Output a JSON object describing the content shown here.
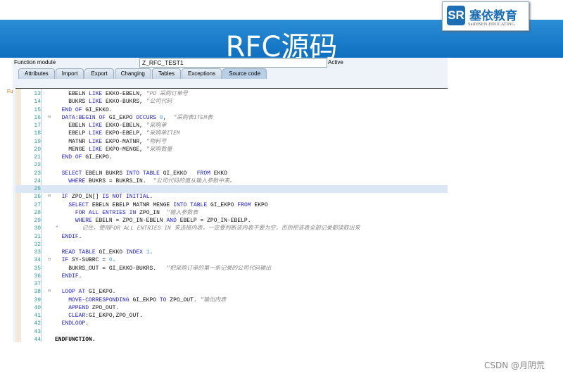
{
  "slide": {
    "title": "RFC源码",
    "logo_cn": "塞依教育",
    "logo_en": "SaiDISEN EDUCATING",
    "logo_mark": "SR",
    "watermark": "CSDN @月阴荒"
  },
  "header": {
    "label": "Function module",
    "value": "Z_RFC_TEST1",
    "status": "Active"
  },
  "tabs": [
    {
      "label": "Attributes"
    },
    {
      "label": "Import"
    },
    {
      "label": "Export"
    },
    {
      "label": "Changing"
    },
    {
      "label": "Tables"
    },
    {
      "label": "Exceptions"
    },
    {
      "label": "Source code",
      "active": true
    }
  ],
  "colors": {
    "keyword": "#2020e0",
    "comment": "#888888",
    "line_number": "#2a9a9a",
    "current_line": "#dbe7f4",
    "banner": "#1a7ecb"
  },
  "code": [
    {
      "n": "13",
      "code": "    EBELN LIKE EKKO-EBELN, ",
      "comment": "\"PO 采购订单号"
    },
    {
      "n": "14",
      "code": "    BUKRS LIKE EKKO-BUKRS, ",
      "comment": "\"公司代码"
    },
    {
      "n": "15",
      "code": "  END OF GI_EKKO."
    },
    {
      "n": "16",
      "fold": true,
      "code": "  DATA:BEGIN OF GI_EKPO OCCURS 0,  ",
      "comment": "\"采购表ITEM表"
    },
    {
      "n": "17",
      "code": "    EBELN LIKE EKKO-EBELN, ",
      "comment": "\"采购单"
    },
    {
      "n": "18",
      "code": "    EBELP LIKE EKPO-EBELP, ",
      "comment": "\"采购单ITEM"
    },
    {
      "n": "19",
      "code": "    MATNR LIKE EKPO-MATNR, ",
      "comment": "\"物料号"
    },
    {
      "n": "20",
      "code": "    MENGE LIKE EKPO-MENGE, ",
      "comment": "\"采购数量"
    },
    {
      "n": "21",
      "code": "  END OF GI_EKPO."
    },
    {
      "n": "22",
      "code": ""
    },
    {
      "n": "23",
      "code": "  SELECT EBELN BUKRS INTO TABLE GI_EKKO   FROM EKKO"
    },
    {
      "n": "24",
      "code": "    WHERE BUKRS = BUKRS_IN.  ",
      "comment": "\"公司代码的值从输入参数中来。"
    },
    {
      "n": "25",
      "code": "",
      "current": true
    },
    {
      "n": "26",
      "fold": true,
      "code": "  IF ZPO_IN[] IS NOT INITIAL."
    },
    {
      "n": "27",
      "code": "    SELECT EBELN EBELP MATNR MENGE INTO TABLE GI_EKPO FROM EKPO"
    },
    {
      "n": "28",
      "code": "      FOR ALL ENTRIES IN ZPO_IN  ",
      "comment": "\"输入参数表"
    },
    {
      "n": "29",
      "code": "      WHERE EBELN = ZPO_IN-EBELN AND EBELP = ZPO_IN-EBELP."
    },
    {
      "n": "30",
      "code": "",
      "comment": "*       记住，使用FOR ALL ENTRIES IN 来连接内表，一定要判断该内表不要为空，否则把该表全部记录都读取出来"
    },
    {
      "n": "31",
      "code": "  ENDIF."
    },
    {
      "n": "32",
      "code": ""
    },
    {
      "n": "33",
      "code": "  READ TABLE GI_EKKO INDEX 1."
    },
    {
      "n": "34",
      "fold": true,
      "code": "  IF SY-SUBRC = 0."
    },
    {
      "n": "35",
      "code": "    BUKRS_OUT = GI_EKKO-BUKRS.   ",
      "comment": "\"把采购订单的第一条记录的公司代码输出"
    },
    {
      "n": "36",
      "code": "  ENDIF."
    },
    {
      "n": "37",
      "code": ""
    },
    {
      "n": "38",
      "fold": true,
      "code": "  LOOP AT GI_EKPO."
    },
    {
      "n": "39",
      "code": "    MOVE-CORRESPONDING GI_EKPO TO ZPO_OUT. ",
      "comment": "\"输出内表"
    },
    {
      "n": "40",
      "code": "    APPEND ZPO_OUT."
    },
    {
      "n": "41",
      "code": "    CLEAR:GI_EKPO,ZPO_OUT."
    },
    {
      "n": "42",
      "code": "  ENDLOOP."
    },
    {
      "n": "43",
      "code": ""
    },
    {
      "n": "44",
      "code": "ENDFUNCTION.",
      "bold": true
    }
  ]
}
